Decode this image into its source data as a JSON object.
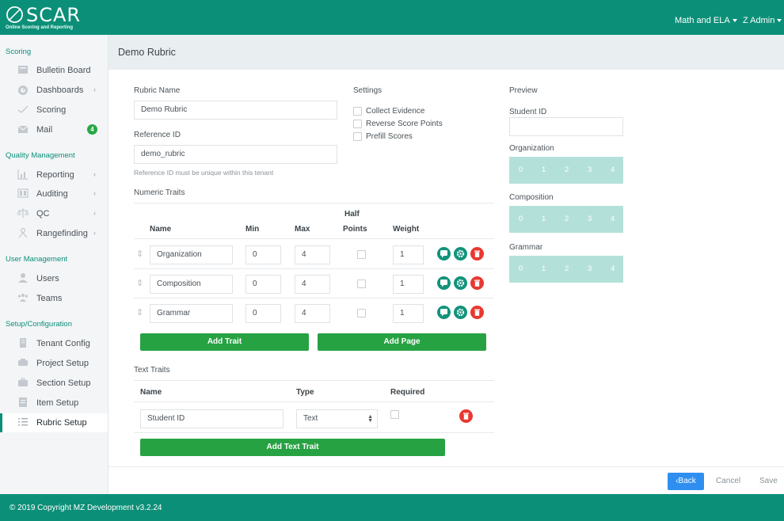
{
  "app": {
    "logo_text": "SCAR",
    "logo_subtitle": "Online Scoring and Reporting",
    "subject_menu": "Math and ELA",
    "user_menu": "Z Admin"
  },
  "sidebar": {
    "sections": {
      "scoring": "Scoring",
      "quality": "Quality Management",
      "users": "User Management",
      "setup": "Setup/Configuration"
    },
    "items": [
      {
        "label": "Bulletin Board",
        "icon": "bulletin-icon"
      },
      {
        "label": "Dashboards",
        "icon": "dashboard-icon"
      },
      {
        "label": "Scoring",
        "icon": "check-icon"
      },
      {
        "label": "Mail",
        "icon": "mail-icon",
        "badge": "4"
      },
      {
        "label": "Reporting",
        "icon": "chart-icon"
      },
      {
        "label": "Auditing",
        "icon": "audit-icon"
      },
      {
        "label": "QC",
        "icon": "qc-icon"
      },
      {
        "label": "Rangefinding",
        "icon": "rangefinding-icon"
      },
      {
        "label": "Users",
        "icon": "user-icon"
      },
      {
        "label": "Teams",
        "icon": "team-icon"
      },
      {
        "label": "Tenant Config",
        "icon": "building-icon"
      },
      {
        "label": "Project Setup",
        "icon": "project-icon"
      },
      {
        "label": "Section Setup",
        "icon": "briefcase-icon"
      },
      {
        "label": "Item Setup",
        "icon": "item-icon"
      },
      {
        "label": "Rubric Setup",
        "icon": "list-icon"
      }
    ]
  },
  "page": {
    "title": "Demo Rubric"
  },
  "form": {
    "rubric_name_label": "Rubric Name",
    "rubric_name_value": "Demo Rubric",
    "reference_id_label": "Reference ID",
    "reference_id_value": "demo_rubric",
    "reference_id_help": "Reference ID must be unique within this tenant",
    "settings_label": "Settings",
    "settings": [
      "Collect Evidence",
      "Reverse Score Points",
      "Prefill Scores"
    ],
    "numeric_traits_label": "Numeric Traits",
    "numeric_headers": {
      "name": "Name",
      "min": "Min",
      "max": "Max",
      "half_points_line1": "Half",
      "half_points_line2": "Points",
      "weight": "Weight"
    },
    "numeric_traits": [
      {
        "name": "Organization",
        "min": "0",
        "max": "4",
        "weight": "1"
      },
      {
        "name": "Composition",
        "min": "0",
        "max": "4",
        "weight": "1"
      },
      {
        "name": "Grammar",
        "min": "0",
        "max": "4",
        "weight": "1"
      }
    ],
    "add_trait": "Add Trait",
    "add_page": "Add Page",
    "text_traits_label": "Text Traits",
    "text_headers": {
      "name": "Name",
      "type": "Type",
      "required": "Required"
    },
    "text_traits": [
      {
        "name": "Student ID",
        "type": "Text"
      }
    ],
    "add_text_trait": "Add Text Trait"
  },
  "preview": {
    "label": "Preview",
    "student_id_label": "Student ID",
    "traits": [
      "Organization",
      "Composition",
      "Grammar"
    ],
    "scale_points": [
      "0",
      "1",
      "2",
      "3",
      "4"
    ]
  },
  "actions": {
    "back": "‹Back",
    "cancel": "Cancel",
    "save": "Save"
  },
  "footer": {
    "copyright": "© 2019 Copyright MZ Development v3.2.24"
  },
  "colors": {
    "brand": "#0c8f78",
    "success": "#27a243",
    "danger": "#e9382f",
    "primary": "#2f8ff0",
    "scale": "#b3e1d9"
  }
}
